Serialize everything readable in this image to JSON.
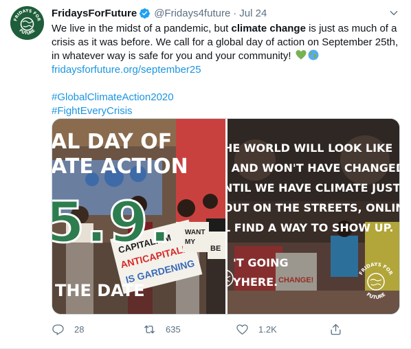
{
  "tweet": {
    "display_name": "FridaysForFuture",
    "handle": "@Fridays4future",
    "separator": "·",
    "date": "Jul 24",
    "text_part1": "We live in the midst of a pandemic, but ",
    "text_bold": "climate change",
    "text_part2": " is just as much of a crisis as it was before. We call for a global day of action on September 25th, in whatever way is safe for you and your community!",
    "link": "fridaysforfuture.org/september25",
    "hashtags": [
      "#GlobalClimateAction2020",
      "#FightEveryCrisis"
    ],
    "emojis": [
      "green-heart",
      "globe"
    ]
  },
  "media": {
    "left_lines": [
      "AL DAY OF",
      "ATE ACTION"
    ],
    "left_date": "5.9.",
    "left_bottom": "THE DATE",
    "left_signs": [
      "CAPITALISM",
      "ANTICAPITALISM",
      "IS GARDENING",
      "WANT",
      "MY",
      "BE"
    ],
    "right_lines": [
      "HE WORLD WILL LOOK LIKE",
      ". AND WON'T HAVE CHANGED.",
      "NTIL WE HAVE CLIMATE JUSTICE,",
      "OUT ON THE STREETS, ONLINE,",
      "L FIND A WAY TO SHOW UP."
    ],
    "right_lower": [
      "'T GOING",
      "YHERE."
    ],
    "logo_text": [
      "FRIDAYS FOR",
      "FUTURE"
    ],
    "right_sign": "CHANGE!"
  },
  "actions": {
    "replies": "28",
    "retweets": "635",
    "likes": "1.2K"
  },
  "colors": {
    "link": "#1b95e0",
    "muted": "#5b7083",
    "brand_green": "#1f5e3a"
  }
}
